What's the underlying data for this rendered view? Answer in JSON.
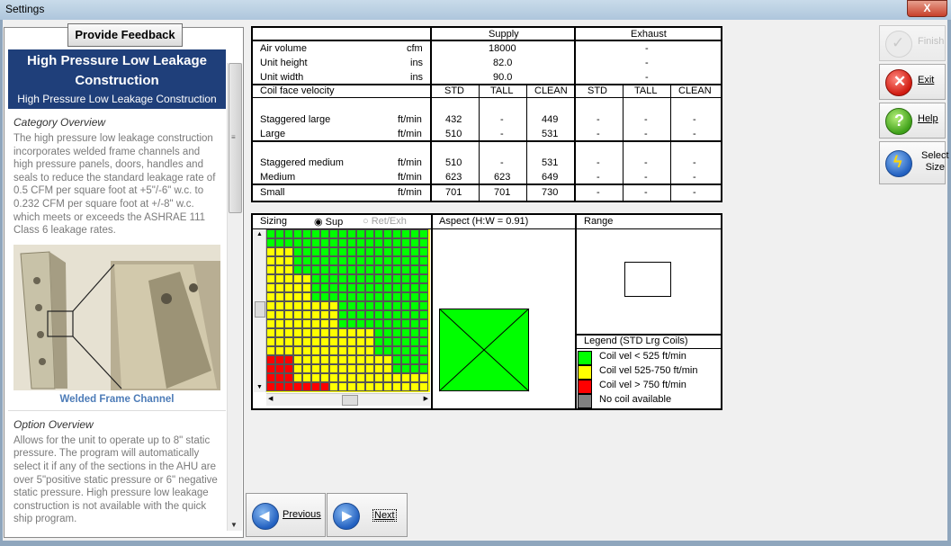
{
  "window": {
    "title": "Settings",
    "close_label": "X"
  },
  "feedback_button": "Provide Feedback",
  "header": {
    "title": "High Pressure Low Leakage Construction",
    "subtitle": "High Pressure Low Leakage Construction"
  },
  "category": {
    "title": "Category Overview",
    "text": "The high pressure low leakage construction incorporates welded frame channels and high pressure panels, doors, handles and seals to reduce the standard leakage rate of 0.5 CFM per square foot at +5\"/-6\" w.c. to 0.232 CFM per square foot at +/-8\" w.c. which meets or exceeds the ASHRAE 111 Class 6 leakage rates."
  },
  "image_caption": "Welded Frame Channel",
  "option": {
    "title": "Option Overview",
    "text": "Allows for the unit to operate up to 8\" static pressure. The program will automatically select it if any of the sections in the AHU are over 5\"positive static pressure or 6\" negative static pressure. High pressure low leakage construction is not available with the quick ship program."
  },
  "table": {
    "supply_header": "Supply",
    "exhaust_header": "Exhaust",
    "rows_top": [
      {
        "label": "Air volume",
        "unit": "cfm",
        "supply": "18000",
        "exhaust": "-"
      },
      {
        "label": "Unit height",
        "unit": "ins",
        "supply": "82.0",
        "exhaust": "-"
      },
      {
        "label": "Unit width",
        "unit": "ins",
        "supply": "90.0",
        "exhaust": "-"
      }
    ],
    "coil_face_label": "Coil face velocity",
    "cols": [
      "STD",
      "TALL",
      "CLEAN",
      "STD",
      "TALL",
      "CLEAN"
    ],
    "rows": [
      {
        "label": "Staggered large",
        "unit": "ft/min",
        "v": [
          "432",
          "-",
          "449",
          "-",
          "-",
          "-"
        ]
      },
      {
        "label": "Large",
        "unit": "ft/min",
        "v": [
          "510",
          "-",
          "531",
          "-",
          "-",
          "-"
        ]
      },
      {
        "label": "Staggered medium",
        "unit": "ft/min",
        "v": [
          "510",
          "-",
          "531",
          "-",
          "-",
          "-"
        ]
      },
      {
        "label": "Medium",
        "unit": "ft/min",
        "v": [
          "623",
          "623",
          "649",
          "-",
          "-",
          "-"
        ]
      },
      {
        "label": "Small",
        "unit": "ft/min",
        "v": [
          "701",
          "701",
          "730",
          "-",
          "-",
          "-"
        ]
      }
    ]
  },
  "sizing": {
    "label": "Sizing",
    "radio_sup": "Sup",
    "radio_ret": "Ret/Exh",
    "aspect_label": "Aspect (H:W = 0.91)",
    "range_label": "Range"
  },
  "legend": {
    "title": "Legend (STD Lrg Coils)",
    "items": [
      {
        "label": "Coil vel < 525 ft/min",
        "color": "#00ff00"
      },
      {
        "label": "Coil vel 525-750 ft/min",
        "color": "#ffff00"
      },
      {
        "label": "Coil vel > 750 ft/min",
        "color": "#ff0000"
      },
      {
        "label": "No coil available",
        "color": "#808080"
      }
    ]
  },
  "actions": {
    "finish": "Finish",
    "exit": "Exit",
    "help": "Help",
    "select_size_1": "Select",
    "select_size_2": "Size"
  },
  "nav": {
    "previous": "Previous",
    "next": "Next"
  }
}
